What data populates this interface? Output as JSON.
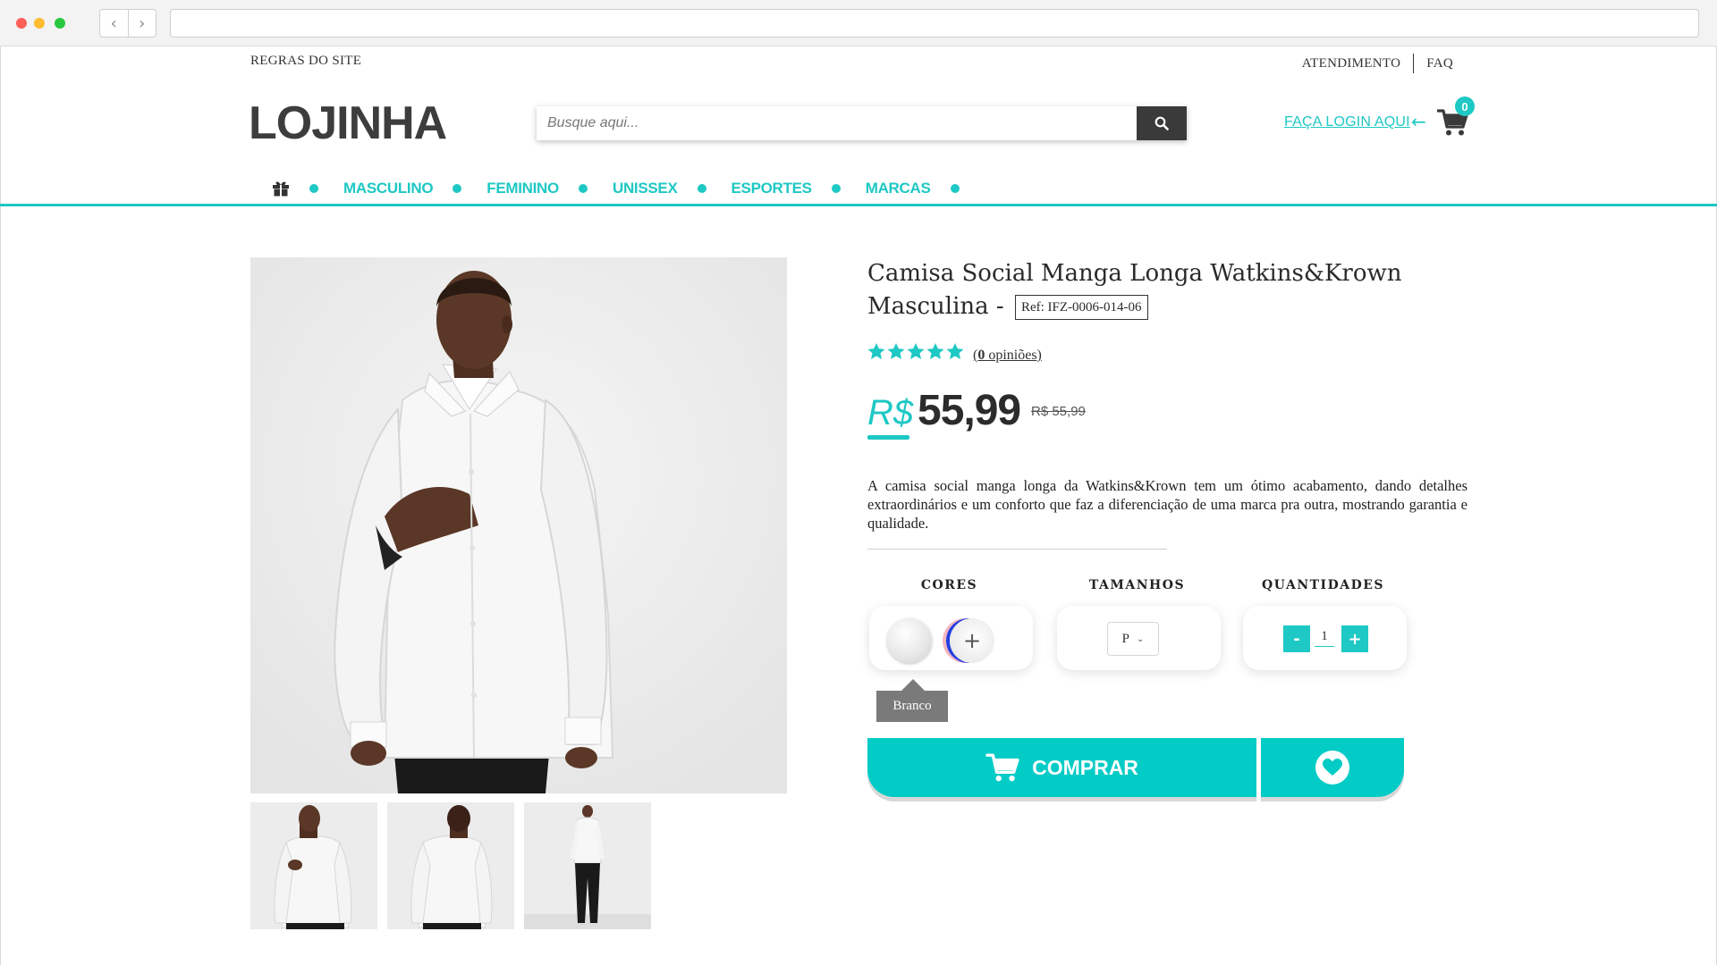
{
  "utility_bar": {
    "site_rules": "REGRAS DO SITE",
    "support": "ATENDIMENTO",
    "faq": "FAQ"
  },
  "header": {
    "logo": "LOJINHA",
    "search_placeholder": "Busque aqui...",
    "login_link": "FAÇA LOGIN AQUI",
    "cart_count": "0"
  },
  "nav": {
    "items": [
      {
        "label": "MASCULINO"
      },
      {
        "label": "FEMININO"
      },
      {
        "label": "UNISSEX"
      },
      {
        "label": "ESPORTES"
      },
      {
        "label": "MARCAS"
      }
    ]
  },
  "product": {
    "title": "Camisa Social Manga Longa Watkins&Krown Masculina -",
    "ref": "Ref: IFZ-0006-014-06",
    "rating": 5,
    "reviews_count": "0",
    "reviews_label": " opiniões",
    "currency": "R$",
    "price": "55,99",
    "old_price": "R$ 55,99",
    "description": "A camisa social manga longa da Watkins&Krown tem um ótimo acabamento, dando detalhes extraordinários e um conforto que faz a diferenciação de uma marca pra outra, mostrando garantia e qualidade."
  },
  "options": {
    "colors_label": "CORES",
    "sizes_label": "TAMANHOS",
    "quantity_label": "QUANTIDADES",
    "selected_color_tooltip": "Branco",
    "more_colors": "+",
    "selected_size": "P",
    "quantity": "1",
    "minus": "-",
    "plus": "+"
  },
  "actions": {
    "buy_label": "COMPRAR"
  },
  "colors": {
    "accent": "#1ec8c4",
    "button": "#03cbc6",
    "dark": "#3a3a3a"
  }
}
